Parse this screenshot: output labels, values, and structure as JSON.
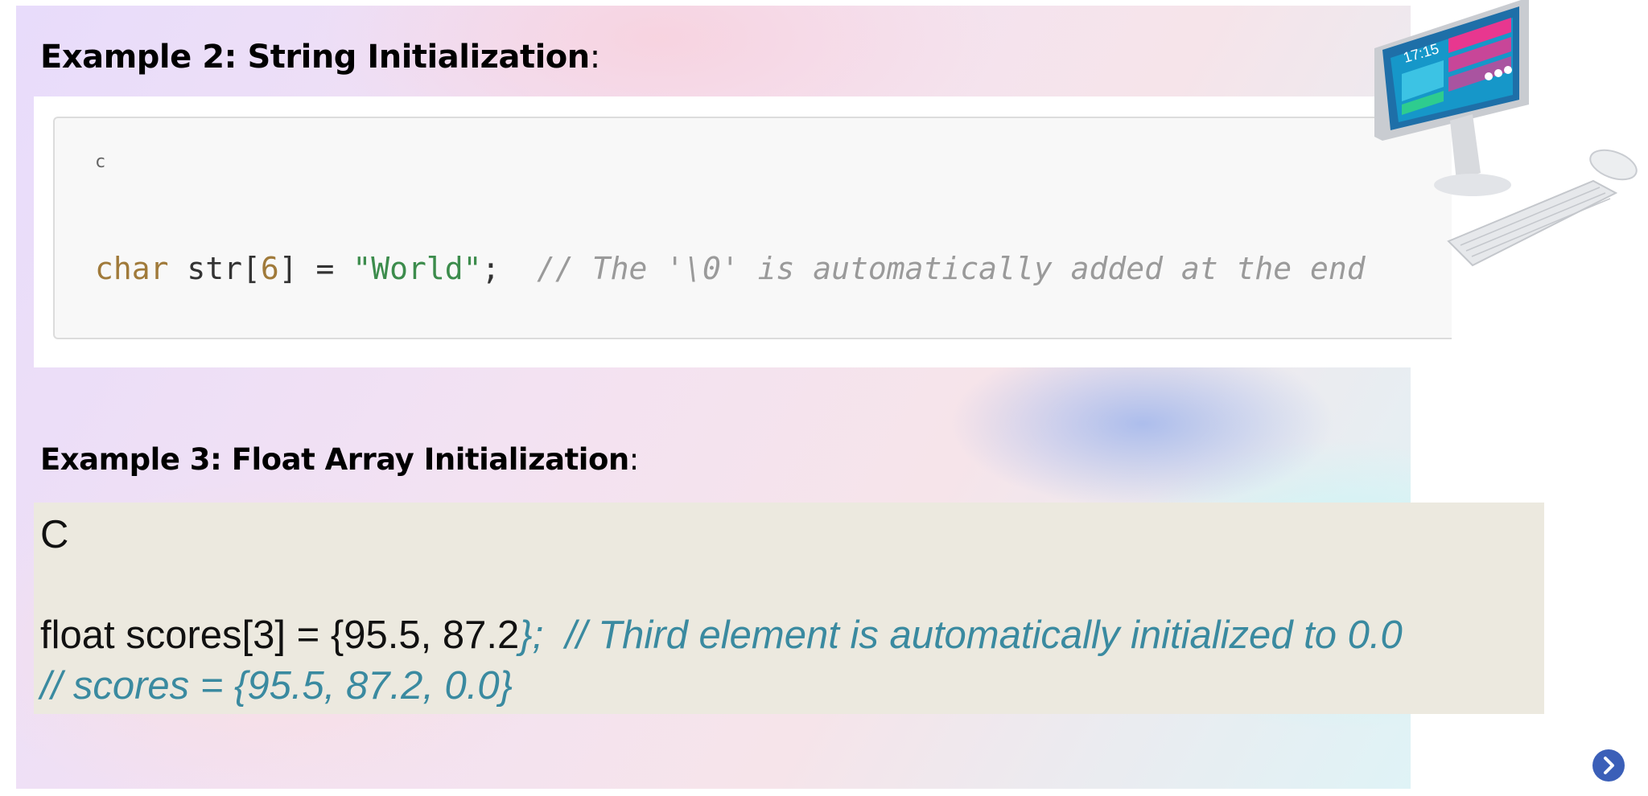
{
  "slide": {
    "example2": {
      "heading_bold": "Example 2: String Initialization",
      "heading_colon": ":",
      "code": {
        "language": "c",
        "tokens": {
          "keyword": "char",
          "name_open": " str[",
          "size": "6",
          "assign": "] = ",
          "string": "\"World\"",
          "semicolon": ";  ",
          "comment": "// The '\\0' is automatically added at the end"
        }
      }
    },
    "example3": {
      "heading_bold": "Example 3: Float Array Initialization",
      "heading_colon": ":",
      "code": {
        "language": "C",
        "line1_code": "float scores[3] = {95.5, 87.2",
        "line1_tail": "};  // Third element is automatically initialized to 0.0",
        "line2": "// scores = {95.5, 87.2, 0.0}"
      }
    },
    "illustration": {
      "icon": "desktop-computer-illustration",
      "screen_time": "17:15"
    },
    "navigation": {
      "next_icon": "chevron-right-icon",
      "accent_color": "#3b5fb8"
    }
  }
}
